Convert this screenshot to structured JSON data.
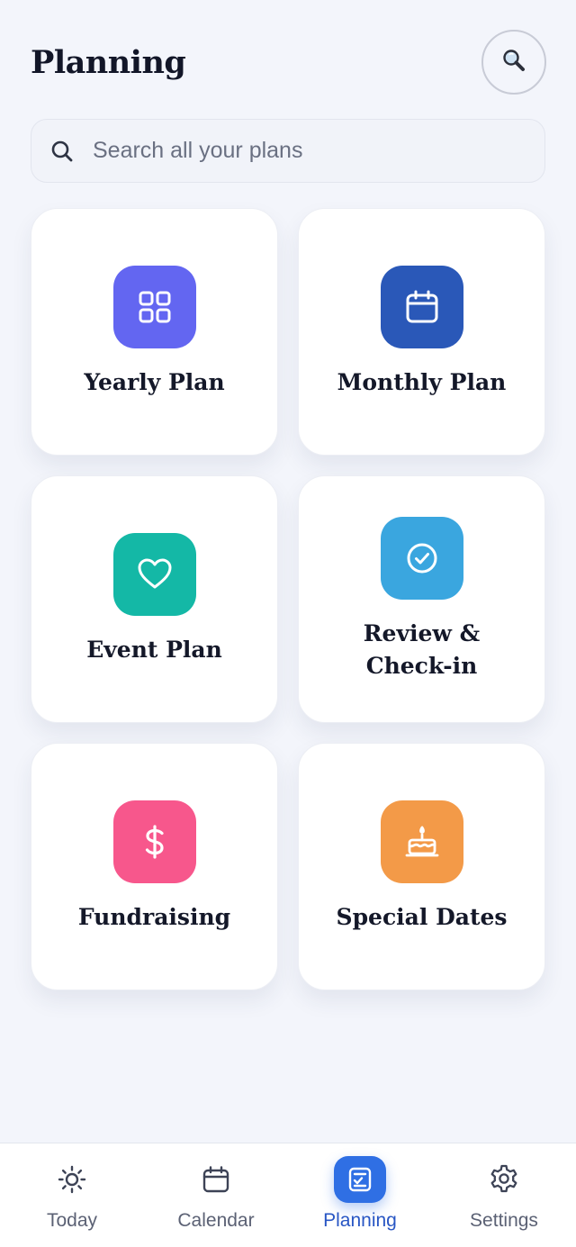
{
  "header": {
    "title": "Planning",
    "search_button_icon": "magnifier-icon"
  },
  "search": {
    "placeholder": "Search all your plans",
    "icon": "search-icon"
  },
  "cards": [
    {
      "label": "Yearly Plan",
      "icon": "grid-icon",
      "color": "#6366f1"
    },
    {
      "label": "Monthly Plan",
      "icon": "calendar-icon",
      "color": "#2a58b8"
    },
    {
      "label": "Event Plan",
      "icon": "heart-icon",
      "color": "#14b8a6"
    },
    {
      "label": "Review &\nCheck-in",
      "icon": "check-circle-icon",
      "color": "#3aa6df"
    },
    {
      "label": "Fundraising",
      "icon": "dollar-icon",
      "color": "#f7578c"
    },
    {
      "label": "Special Dates",
      "icon": "cake-icon",
      "color": "#f39a48"
    }
  ],
  "nav": {
    "items": [
      {
        "label": "Today",
        "icon": "sun-icon",
        "active": false
      },
      {
        "label": "Calendar",
        "icon": "calendar-icon",
        "active": false
      },
      {
        "label": "Planning",
        "icon": "checklist-icon",
        "active": true
      },
      {
        "label": "Settings",
        "icon": "gear-icon",
        "active": false
      }
    ],
    "active_color": "#2f6fe4"
  }
}
